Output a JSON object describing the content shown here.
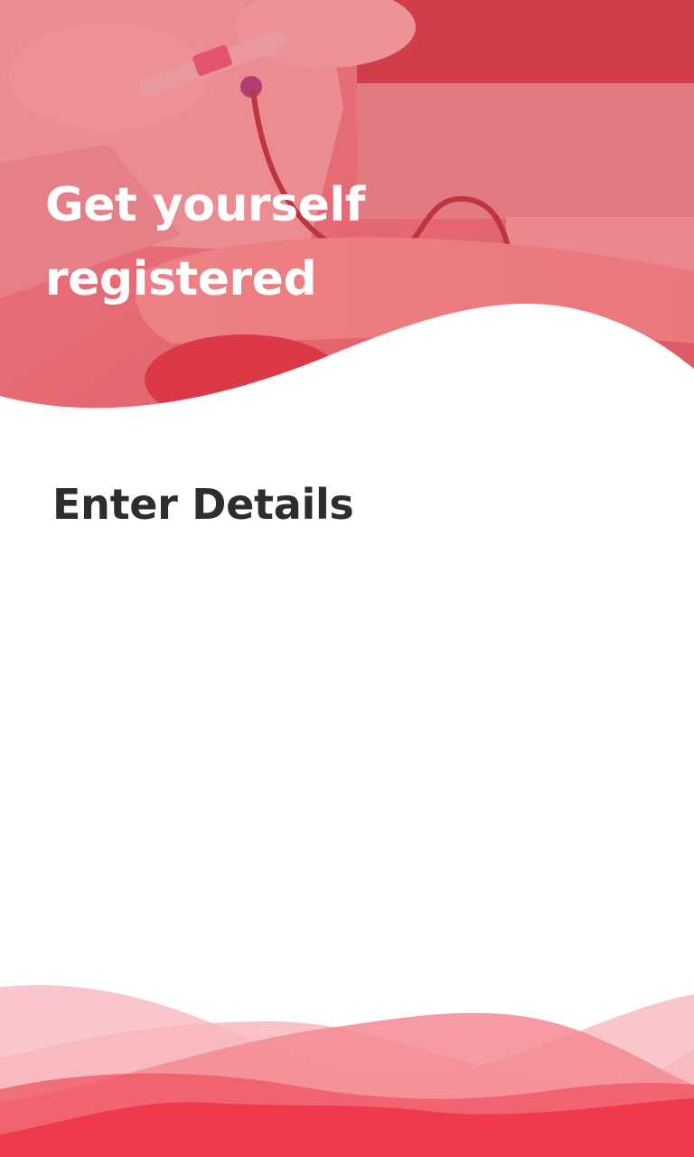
{
  "header": {
    "title_line1": "Get yourself",
    "title_line2": "registered",
    "image_icon": "blood-donation-photo",
    "overlay_color": "#e0434f"
  },
  "form": {
    "section_title": "Enter Details"
  },
  "footer": {
    "decoration": "red-wave-decoration",
    "colors": [
      "#f9c7cb",
      "#f48a93",
      "#ef5562",
      "#f0394a"
    ]
  }
}
